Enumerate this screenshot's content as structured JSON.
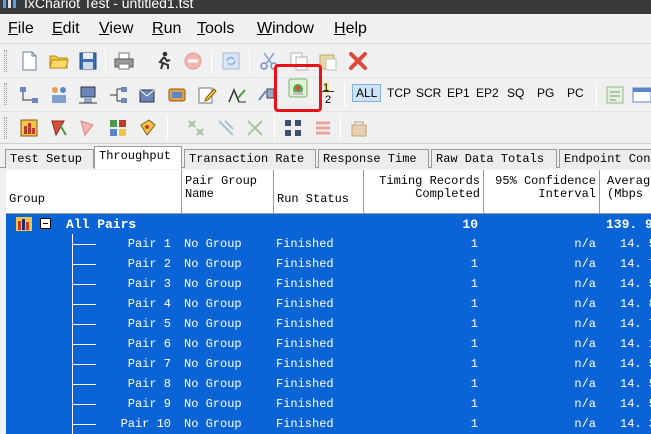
{
  "window": {
    "title": "IxChariot Test - untitled1.tst"
  },
  "menu": [
    {
      "label": "File",
      "underline": "F",
      "rest": "ile"
    },
    {
      "label": "Edit",
      "underline": "E",
      "rest": "dit"
    },
    {
      "label": "View",
      "underline": "V",
      "rest": "iew"
    },
    {
      "label": "Run",
      "underline": "R",
      "rest": "un"
    },
    {
      "label": "Tools",
      "underline": "T",
      "rest": "ools"
    },
    {
      "label": "Window",
      "underline": "W",
      "rest": "indow"
    },
    {
      "label": "Help",
      "underline": "H",
      "rest": "elp"
    }
  ],
  "protocols": [
    "ALL",
    "TCP",
    "SCR",
    "EP1",
    "EP2",
    "SQ",
    "PG",
    "PC"
  ],
  "protocol_active": "ALL",
  "pair_toggle_label": {
    "top": "1",
    "bottom": "2"
  },
  "tabs": [
    "Test Setup",
    "Throughput",
    "Transaction Rate",
    "Response Time",
    "Raw Data Totals",
    "Endpoint Con"
  ],
  "active_tab": "Throughput",
  "columns": {
    "group": "Group",
    "pair_group_1": "Pair Group",
    "pair_group_2": "Name",
    "run_status": "Run Status",
    "timing_1": "Timing Records",
    "timing_2": "Completed",
    "confidence_1": "95% Confidence",
    "confidence_2": "Interval",
    "average_1": "Averag",
    "average_2": "(Mbps"
  },
  "summary": {
    "label": "All Pairs",
    "timing": "10",
    "average": "139. 9"
  },
  "rows": [
    {
      "pair": "Pair 1",
      "group": "No Group",
      "status": "Finished",
      "timing": "1",
      "confidence": "n/a",
      "average": "14. 5"
    },
    {
      "pair": "Pair 2",
      "group": "No Group",
      "status": "Finished",
      "timing": "1",
      "confidence": "n/a",
      "average": "14. 7"
    },
    {
      "pair": "Pair 3",
      "group": "No Group",
      "status": "Finished",
      "timing": "1",
      "confidence": "n/a",
      "average": "14. 5"
    },
    {
      "pair": "Pair 4",
      "group": "No Group",
      "status": "Finished",
      "timing": "1",
      "confidence": "n/a",
      "average": "14. 8"
    },
    {
      "pair": "Pair 5",
      "group": "No Group",
      "status": "Finished",
      "timing": "1",
      "confidence": "n/a",
      "average": "14. 7"
    },
    {
      "pair": "Pair 6",
      "group": "No Group",
      "status": "Finished",
      "timing": "1",
      "confidence": "n/a",
      "average": "14. 1"
    },
    {
      "pair": "Pair 7",
      "group": "No Group",
      "status": "Finished",
      "timing": "1",
      "confidence": "n/a",
      "average": "14. 5"
    },
    {
      "pair": "Pair 8",
      "group": "No Group",
      "status": "Finished",
      "timing": "1",
      "confidence": "n/a",
      "average": "14. 5"
    },
    {
      "pair": "Pair 9",
      "group": "No Group",
      "status": "Finished",
      "timing": "1",
      "confidence": "n/a",
      "average": "14. 5"
    },
    {
      "pair": "Pair 10",
      "group": "No Group",
      "status": "Finished",
      "timing": "1",
      "confidence": "n/a",
      "average": "14. 3"
    }
  ],
  "colors": {
    "selection": "#0a64d6",
    "highlight": "#e8131a",
    "titlebar": "#3a3a3a"
  }
}
